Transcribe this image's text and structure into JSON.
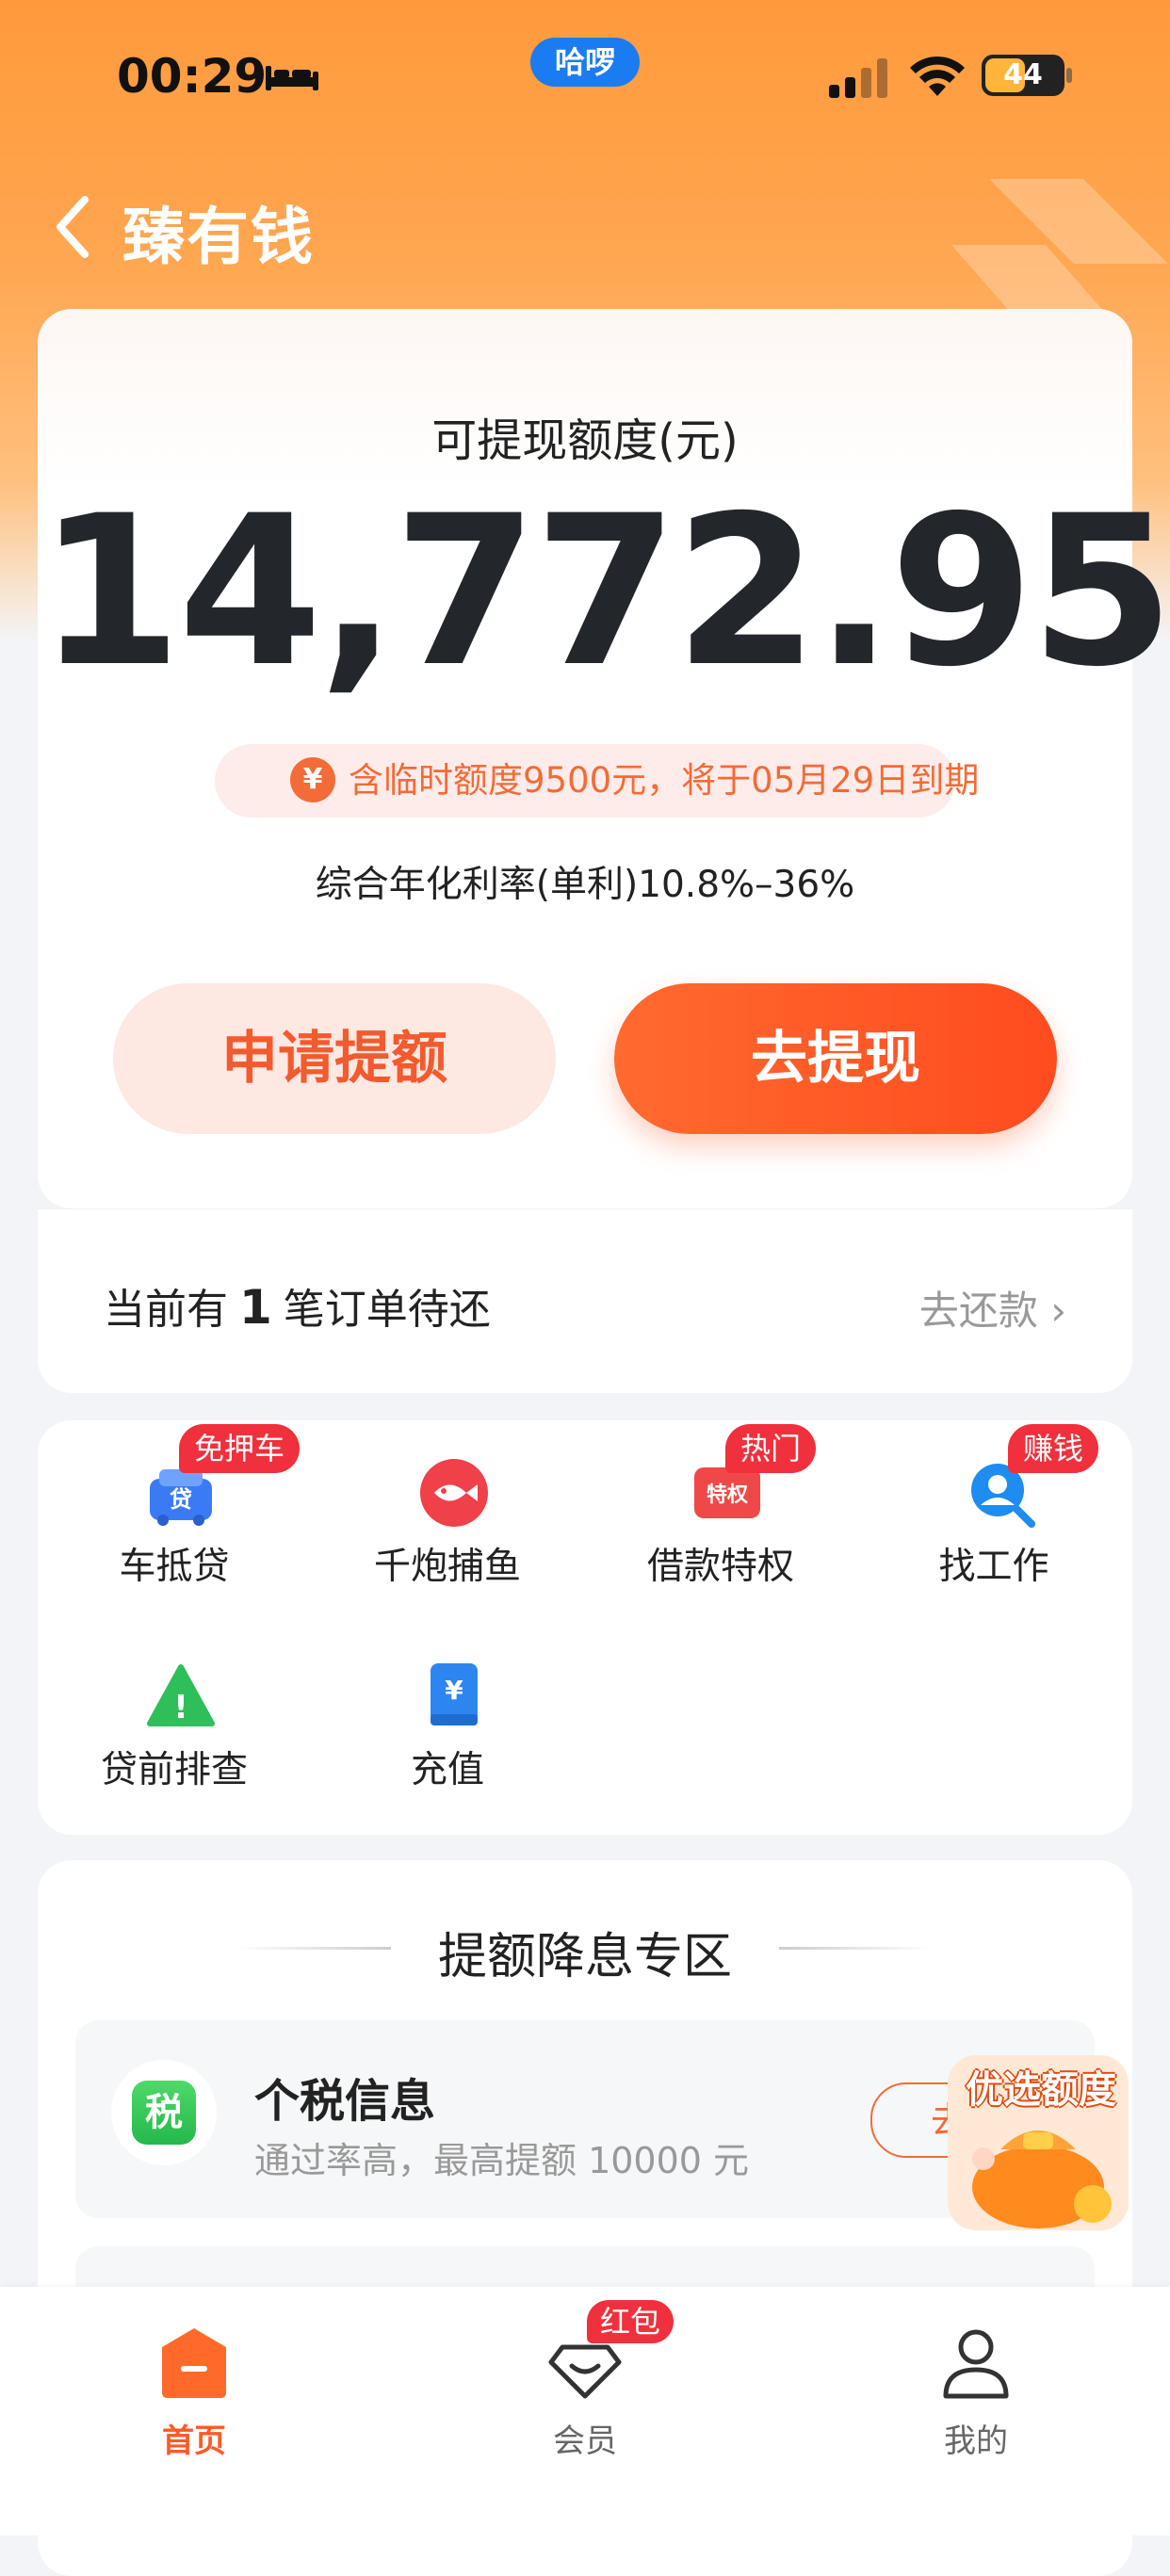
{
  "status_bar": {
    "time": "00:29",
    "center_pill": "哈啰",
    "battery": "44"
  },
  "header": {
    "title": "臻有钱"
  },
  "credit": {
    "label": "可提现额度(元)",
    "amount": "14,772.95",
    "notice": "含临时额度9500元，将于05月29日到期",
    "rate": "综合年化利率(单利)10.8%–36%",
    "apply_button": "申请提额",
    "withdraw_button": "去提现"
  },
  "order": {
    "prefix": "当前有",
    "count": "1",
    "suffix": "笔订单待还",
    "link": "去还款"
  },
  "services": [
    {
      "label": "车抵贷",
      "tag": "免押车",
      "icon": "car-loan-icon",
      "icon_text": "贷"
    },
    {
      "label": "千炮捕鱼",
      "tag": "",
      "icon": "fish-icon"
    },
    {
      "label": "借款特权",
      "tag": "热门",
      "icon": "privilege-icon",
      "icon_text": "特权"
    },
    {
      "label": "找工作",
      "tag": "赚钱",
      "icon": "job-search-icon"
    },
    {
      "label": "贷前排查",
      "tag": "",
      "icon": "warning-icon",
      "icon_text": "!"
    },
    {
      "label": "充值",
      "tag": "",
      "icon": "recharge-icon",
      "icon_text": "¥"
    }
  ],
  "zone": {
    "title": "提额降息专区",
    "tasks": [
      {
        "icon_text": "税",
        "title": "个税信息",
        "subtitle": "通过率高，最高提额 10000 元",
        "button": "去认"
      }
    ]
  },
  "promo": {
    "label": "优选额度"
  },
  "tabbar": [
    {
      "label": "首页",
      "active": true,
      "icon": "home-icon"
    },
    {
      "label": "会员",
      "badge": "红包",
      "icon": "member-icon"
    },
    {
      "label": "我的",
      "icon": "profile-icon"
    }
  ],
  "colors": {
    "accent": "#ff5a26",
    "brand_orange": "#ff9a3c",
    "badge_red": "#f0303c",
    "notice_text": "#f36b36"
  }
}
